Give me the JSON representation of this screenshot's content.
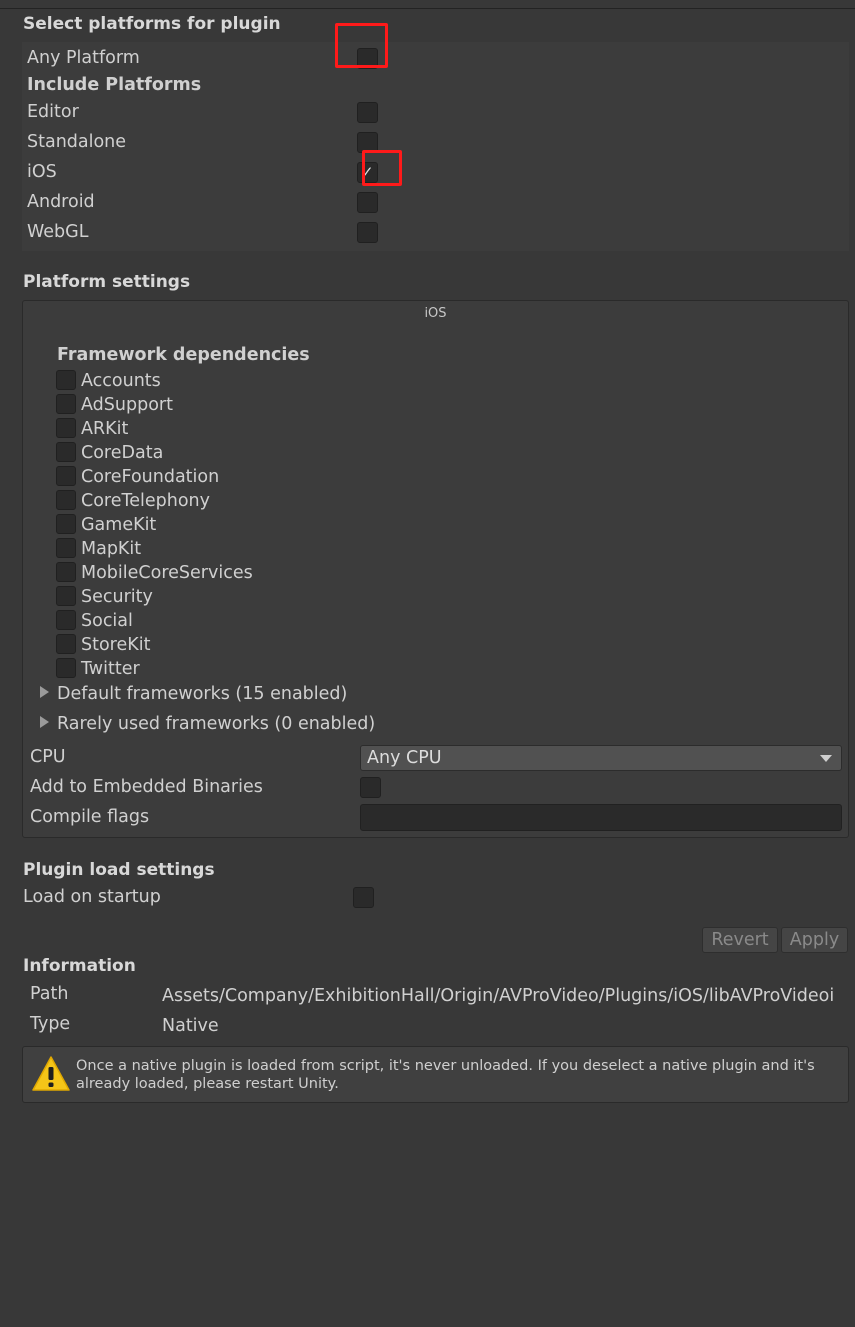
{
  "select_platforms": {
    "title": "Select platforms for plugin",
    "any_platform_label": "Any Platform",
    "any_platform_checked": false,
    "include_platforms_label": "Include Platforms",
    "platforms": [
      {
        "label": "Editor",
        "checked": false
      },
      {
        "label": "Standalone",
        "checked": false
      },
      {
        "label": "iOS",
        "checked": true
      },
      {
        "label": "Android",
        "checked": false
      },
      {
        "label": "WebGL",
        "checked": false
      }
    ]
  },
  "platform_settings": {
    "title": "Platform settings",
    "tab": "iOS",
    "framework_dependencies_label": "Framework dependencies",
    "frameworks": [
      {
        "label": "Accounts",
        "checked": false
      },
      {
        "label": "AdSupport",
        "checked": false
      },
      {
        "label": "ARKit",
        "checked": false
      },
      {
        "label": "CoreData",
        "checked": false
      },
      {
        "label": "CoreFoundation",
        "checked": false
      },
      {
        "label": "CoreTelephony",
        "checked": false
      },
      {
        "label": "GameKit",
        "checked": false
      },
      {
        "label": "MapKit",
        "checked": false
      },
      {
        "label": "MobileCoreServices",
        "checked": false
      },
      {
        "label": "Security",
        "checked": false
      },
      {
        "label": "Social",
        "checked": false
      },
      {
        "label": "StoreKit",
        "checked": false
      },
      {
        "label": "Twitter",
        "checked": false
      }
    ],
    "default_frameworks_label": "Default frameworks (15 enabled)",
    "rarely_used_frameworks_label": "Rarely used frameworks (0 enabled)",
    "cpu_label": "CPU",
    "cpu_value": "Any CPU",
    "embedded_binaries_label": "Add to Embedded Binaries",
    "compile_flags_label": "Compile flags",
    "compile_flags_value": ""
  },
  "plugin_load": {
    "title": "Plugin load settings",
    "load_on_startup_label": "Load on startup"
  },
  "buttons": {
    "revert": "Revert",
    "apply": "Apply"
  },
  "information": {
    "title": "Information",
    "path_label": "Path",
    "path_value": "Assets/Company/ExhibitionHall/Origin/AVProVideo/Plugins/iOS/libAVProVideoi",
    "type_label": "Type",
    "type_value": "Native"
  },
  "help": {
    "message": "Once a native plugin is loaded from script, it's never unloaded. If you deselect a native plugin and it's already loaded, please restart Unity.",
    "icon": "warning-icon"
  },
  "colors": {
    "background": "#383838",
    "highlight_red": "#ff1a1a",
    "warning_yellow": "#f5c518"
  }
}
